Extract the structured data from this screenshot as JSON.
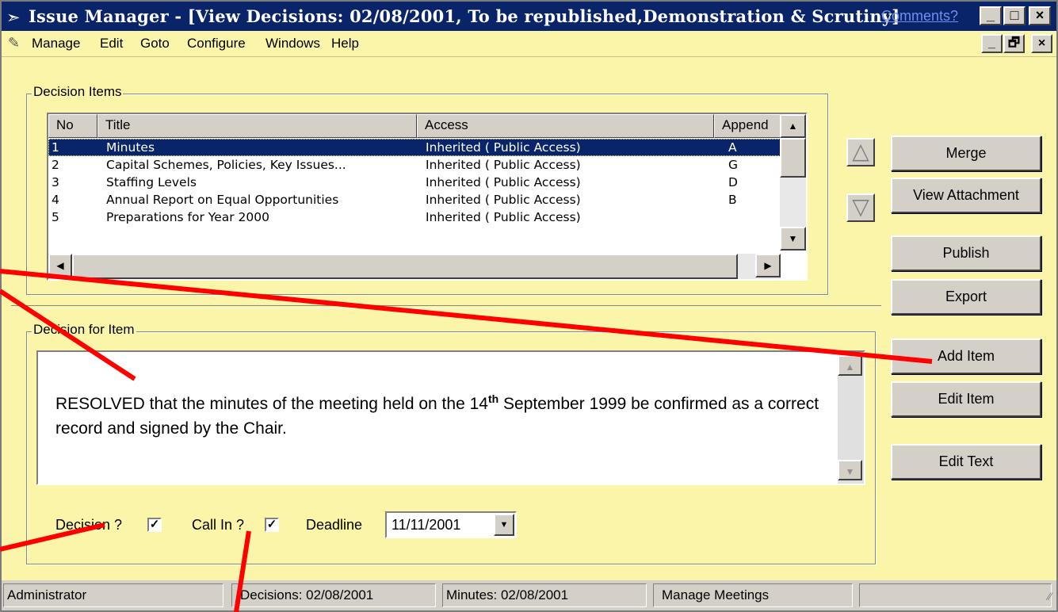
{
  "window": {
    "title": "Issue Manager - [View Decisions: 02/08/2001, To be republished,Demonstration &  Scrutiny]",
    "comments_link": "Comments?",
    "caption_buttons": [
      "_",
      "□",
      "×"
    ],
    "mdi_buttons": [
      "_",
      "🗗",
      "×"
    ]
  },
  "menu": {
    "items": [
      "Manage",
      "Edit",
      "Goto",
      "Configure",
      "Windows",
      "Help"
    ]
  },
  "decision_items": {
    "group_label": "Decision Items",
    "columns": [
      "No",
      "Title",
      "Access",
      "Append"
    ],
    "rows": [
      {
        "no": "1",
        "title": "Minutes",
        "access": "Inherited ( Public Access)",
        "append": "A",
        "selected": true
      },
      {
        "no": "2",
        "title": "Capital Schemes, Policies, Key Issues...",
        "access": "Inherited ( Public Access)",
        "append": "G",
        "selected": false
      },
      {
        "no": "3",
        "title": "Staffing Levels",
        "access": "Inherited ( Public Access)",
        "append": "D",
        "selected": false
      },
      {
        "no": "4",
        "title": "Annual Report on Equal Opportunities",
        "access": "Inherited ( Public Access)",
        "append": "B",
        "selected": false
      },
      {
        "no": "5",
        "title": "Preparations for Year 2000",
        "access": "Inherited ( Public Access)",
        "append": "",
        "selected": false
      }
    ]
  },
  "buttons": {
    "merge": "Merge",
    "view_attachment": "View Attachment",
    "publish": "Publish",
    "export": "Export",
    "add_item": "Add Item",
    "edit_item": "Edit Item",
    "edit_text": "Edit Text"
  },
  "decision_for_item": {
    "group_label": "Decision for Item",
    "text_before": "RESOLVED that the minutes of the meeting held on the 14",
    "text_sup": "th",
    "text_after": " September 1999 be confirmed as a correct record and signed by the Chair."
  },
  "form": {
    "decision_label": "Decision ?",
    "decision_checked": true,
    "call_in_label": "Call In ?",
    "call_in_checked": true,
    "deadline_label": "Deadline",
    "deadline_value": "11/11/2001"
  },
  "status_bar": {
    "panes": [
      "Administrator",
      "Decisions: 02/08/2001",
      "Minutes: 02/08/2001",
      "Manage Meetings",
      ""
    ]
  },
  "colors": {
    "window_bg": "#faf5a8",
    "title_bar": "#0a246a",
    "selection": "#0a246a",
    "annotation_lines": "#ff0000"
  }
}
